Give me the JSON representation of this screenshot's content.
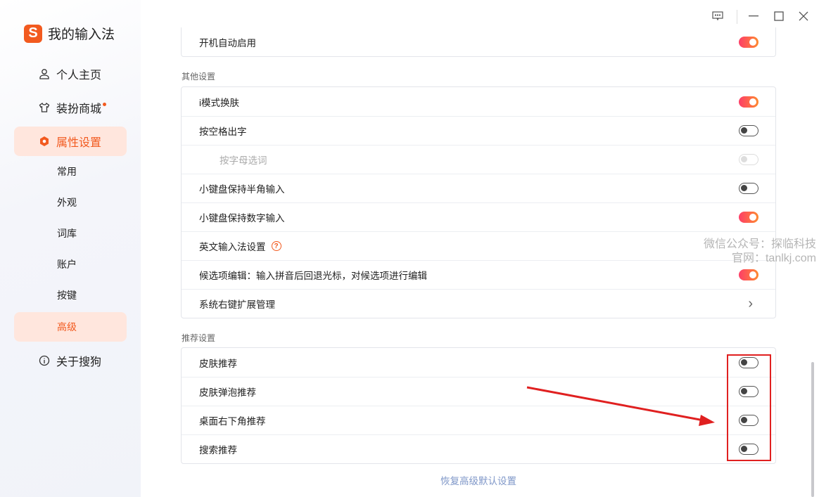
{
  "app": {
    "title": "我的输入法"
  },
  "nav": [
    {
      "label": "个人主页",
      "icon": "user-icon"
    },
    {
      "label": "装扮商城",
      "icon": "shirt-icon"
    },
    {
      "label": "属性设置",
      "icon": "hexagon-icon"
    },
    {
      "label": "关于搜狗",
      "icon": "info-icon"
    }
  ],
  "subnav": [
    "常用",
    "外观",
    "词库",
    "账户",
    "按键",
    "高级"
  ],
  "top_card": [
    {
      "label": "开机自动启用",
      "state": "on"
    }
  ],
  "other": {
    "title": "其他设置",
    "rows": [
      {
        "label": "i模式换肤",
        "state": "on"
      },
      {
        "label": "按空格出字",
        "state": "off"
      },
      {
        "label": "按字母选词",
        "state": "disabled"
      },
      {
        "label": "小键盘保持半角输入",
        "state": "off"
      },
      {
        "label": "小键盘保持数字输入",
        "state": "on"
      },
      {
        "label": "英文输入法设置",
        "help": "?"
      },
      {
        "label": "候选项编辑：输入拼音后回退光标，对候选项进行编辑",
        "state": "on"
      },
      {
        "label": "系统右键扩展管理",
        "chevron": "›"
      }
    ]
  },
  "recommend": {
    "title": "推荐设置",
    "rows": [
      {
        "label": "皮肤推荐",
        "state": "off"
      },
      {
        "label": "皮肤弹泡推荐",
        "state": "off"
      },
      {
        "label": "桌面右下角推荐",
        "state": "off"
      },
      {
        "label": "搜索推荐",
        "state": "off"
      }
    ]
  },
  "reset_label": "恢复高级默认设置",
  "watermark": {
    "line1": "微信公众号：探临科技",
    "line2": "官网：tanlkj.com"
  },
  "colors": {
    "accent": "#f25a1f",
    "annotation": "#e02020"
  }
}
